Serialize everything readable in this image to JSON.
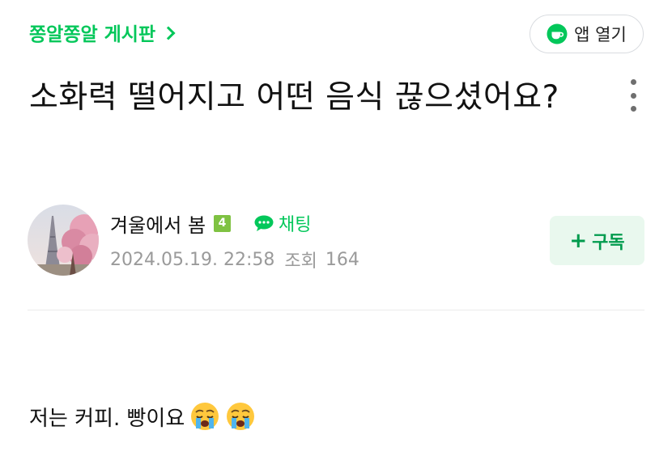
{
  "header": {
    "board_name": "쫑알쫑알 게시판",
    "app_open_label": "앱 열기"
  },
  "post": {
    "title": "소화력 떨어지고 어떤 음식 끊으셨어요?",
    "author": {
      "name": "겨울에서 봄",
      "level": "4",
      "chat_label": "채팅"
    },
    "date": "2024.05.19. 22:58",
    "views_label": "조회",
    "views": "164",
    "subscribe_label": "구독",
    "body": "저는 커피. 빵이요",
    "body_emojis": [
      "crying-face-emoji",
      "crying-face-emoji"
    ]
  },
  "icons": {
    "board_chevron": "chevron-right-icon",
    "app_open": "cafe-cup-icon",
    "more": "more-vertical-icon",
    "chat": "chat-bubble-icon",
    "subscribe": "plus-icon"
  },
  "colors": {
    "brand_green": "#03c75a",
    "subscribe_bg": "#e9f8ee",
    "subscribe_text": "#009b4d",
    "meta_gray": "#9a9a9a",
    "level_badge": "#7fc242"
  }
}
